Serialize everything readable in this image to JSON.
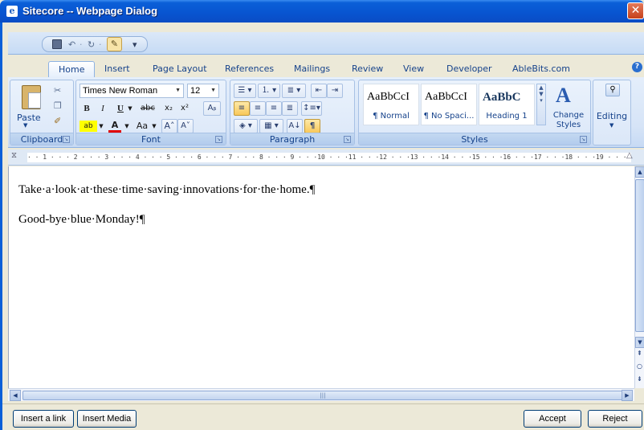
{
  "window": {
    "title": "Sitecore -- Webpage Dialog",
    "close": "✕"
  },
  "qat": {
    "undo": "↶",
    "redo": "↻",
    "separator": "·",
    "customize": "▾"
  },
  "ribbon": {
    "tabs": [
      "Home",
      "Insert",
      "Page Layout",
      "References",
      "Mailings",
      "Review",
      "View",
      "Developer",
      "AbleBits.com"
    ],
    "active_tab": "Home",
    "help": "?",
    "groups": {
      "clipboard": {
        "label": "Clipboard",
        "paste": "Paste"
      },
      "font": {
        "label": "Font",
        "font_name": "Times New Roman",
        "font_size": "12"
      },
      "paragraph": {
        "label": "Paragraph"
      },
      "styles": {
        "label": "Styles",
        "items": [
          {
            "sample": "AaBbCcI",
            "name": "¶ Normal"
          },
          {
            "sample": "AaBbCcI",
            "name": "¶ No Spaci..."
          },
          {
            "sample": "AaBbC",
            "name": "Heading 1"
          }
        ],
        "change_styles": "Change Styles"
      },
      "editing": {
        "label": "Editing"
      }
    }
  },
  "ruler": {
    "text": "· · 1 · · · 2 · · · 3 · · · 4 · · · 5 · · · 6 · · · 7 · · · 8 · · · 9 · · ·10 · · ·11 · · ·12 · · ·13 · · ·14 · · ·15 · · ·16 · · ·17 · · ·18 · · ·19 · · ·"
  },
  "document": {
    "paragraphs": [
      "Take·a·look·at·these·time·saving·innovations·for·the·home.¶",
      "Good-bye·blue·Monday!¶"
    ]
  },
  "footer": {
    "insert_link": "Insert a link",
    "insert_media": "Insert Media",
    "accept": "Accept",
    "reject": "Reject"
  }
}
